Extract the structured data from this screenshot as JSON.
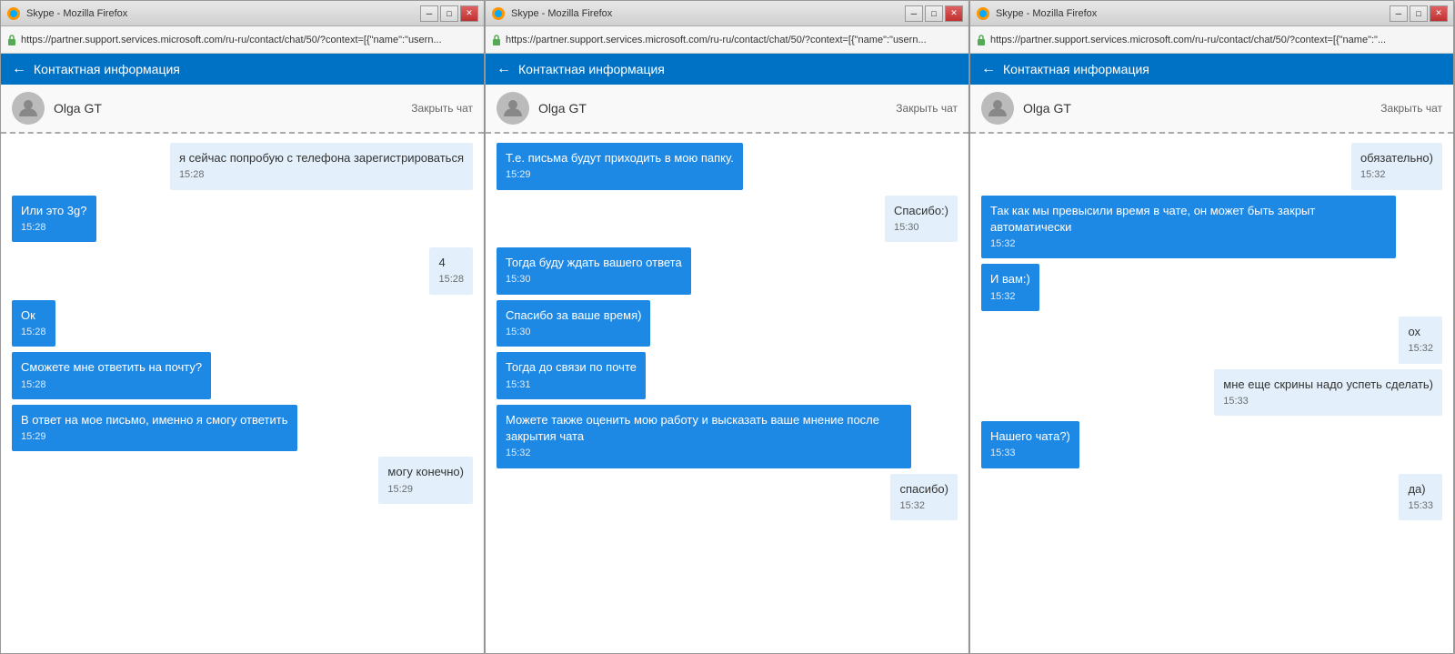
{
  "windows": [
    {
      "id": "window1",
      "title": "Skype - Mozilla Firefox",
      "url": "https://partner.support.services.microsoft.com/ru-ru/contact/chat/50/?context=[{\"name\":\"usern...",
      "header": "← Контактная информация",
      "contact": "Olga GT",
      "close_chat": "Закрыть чат",
      "messages": [
        {
          "type": "user",
          "text": "я сейчас попробую с телефона зарегистрироваться",
          "time": "15:28"
        },
        {
          "type": "agent",
          "text": "Или это 3g?",
          "time": "15:28"
        },
        {
          "type": "user",
          "text": "4",
          "time": "15:28"
        },
        {
          "type": "agent",
          "text": "Ок",
          "time": "15:28"
        },
        {
          "type": "agent",
          "text": "Сможете мне ответить на почту?",
          "time": "15:28"
        },
        {
          "type": "agent",
          "text": "В ответ на мое письмо, именно я смогу ответить",
          "time": "15:29"
        },
        {
          "type": "user",
          "text": "могу конечно)",
          "time": "15:29"
        }
      ]
    },
    {
      "id": "window2",
      "title": "Skype - Mozilla Firefox",
      "url": "https://partner.support.services.microsoft.com/ru-ru/contact/chat/50/?context=[{\"name\":\"usern...",
      "header": "← Контактная информация",
      "contact": "Olga GT",
      "close_chat": "Закрыть чат",
      "messages": [
        {
          "type": "agent",
          "text": "Т.е. письма будут приходить в мою папку.",
          "time": "15:29"
        },
        {
          "type": "user",
          "text": "Спасибо:)",
          "time": "15:30"
        },
        {
          "type": "agent",
          "text": "Тогда буду ждать вашего ответа",
          "time": "15:30"
        },
        {
          "type": "agent",
          "text": "Спасибо за ваше время)",
          "time": "15:30"
        },
        {
          "type": "agent",
          "text": "Тогда до связи по почте",
          "time": "15:31"
        },
        {
          "type": "agent",
          "text": "Можете также оценить мою работу и высказать ваше мнение после закрытия чата",
          "time": "15:32"
        },
        {
          "type": "user",
          "text": "спасибо)",
          "time": "15:32"
        }
      ]
    },
    {
      "id": "window3",
      "title": "Skype - Mozilla Firefox",
      "url": "https://partner.support.services.microsoft.com/ru-ru/contact/chat/50/?context=[{\"name\":\"...",
      "header": "← Контактная информация",
      "contact": "Olga GT",
      "close_chat": "Закрыть чат",
      "messages": [
        {
          "type": "user",
          "text": "обязательно)",
          "time": "15:32"
        },
        {
          "type": "agent",
          "text": "Так как мы превысили время в чате, он может быть закрыт автоматически",
          "time": "15:32"
        },
        {
          "type": "agent",
          "text": "И вам:)",
          "time": "15:32"
        },
        {
          "type": "user",
          "text": "ох",
          "time": "15:32"
        },
        {
          "type": "user",
          "text": "мне еще скрины надо успеть сделать)",
          "time": "15:33"
        },
        {
          "type": "agent",
          "text": "Нашего чата?)",
          "time": "15:33"
        },
        {
          "type": "user",
          "text": "да)",
          "time": "15:33"
        }
      ]
    }
  ]
}
